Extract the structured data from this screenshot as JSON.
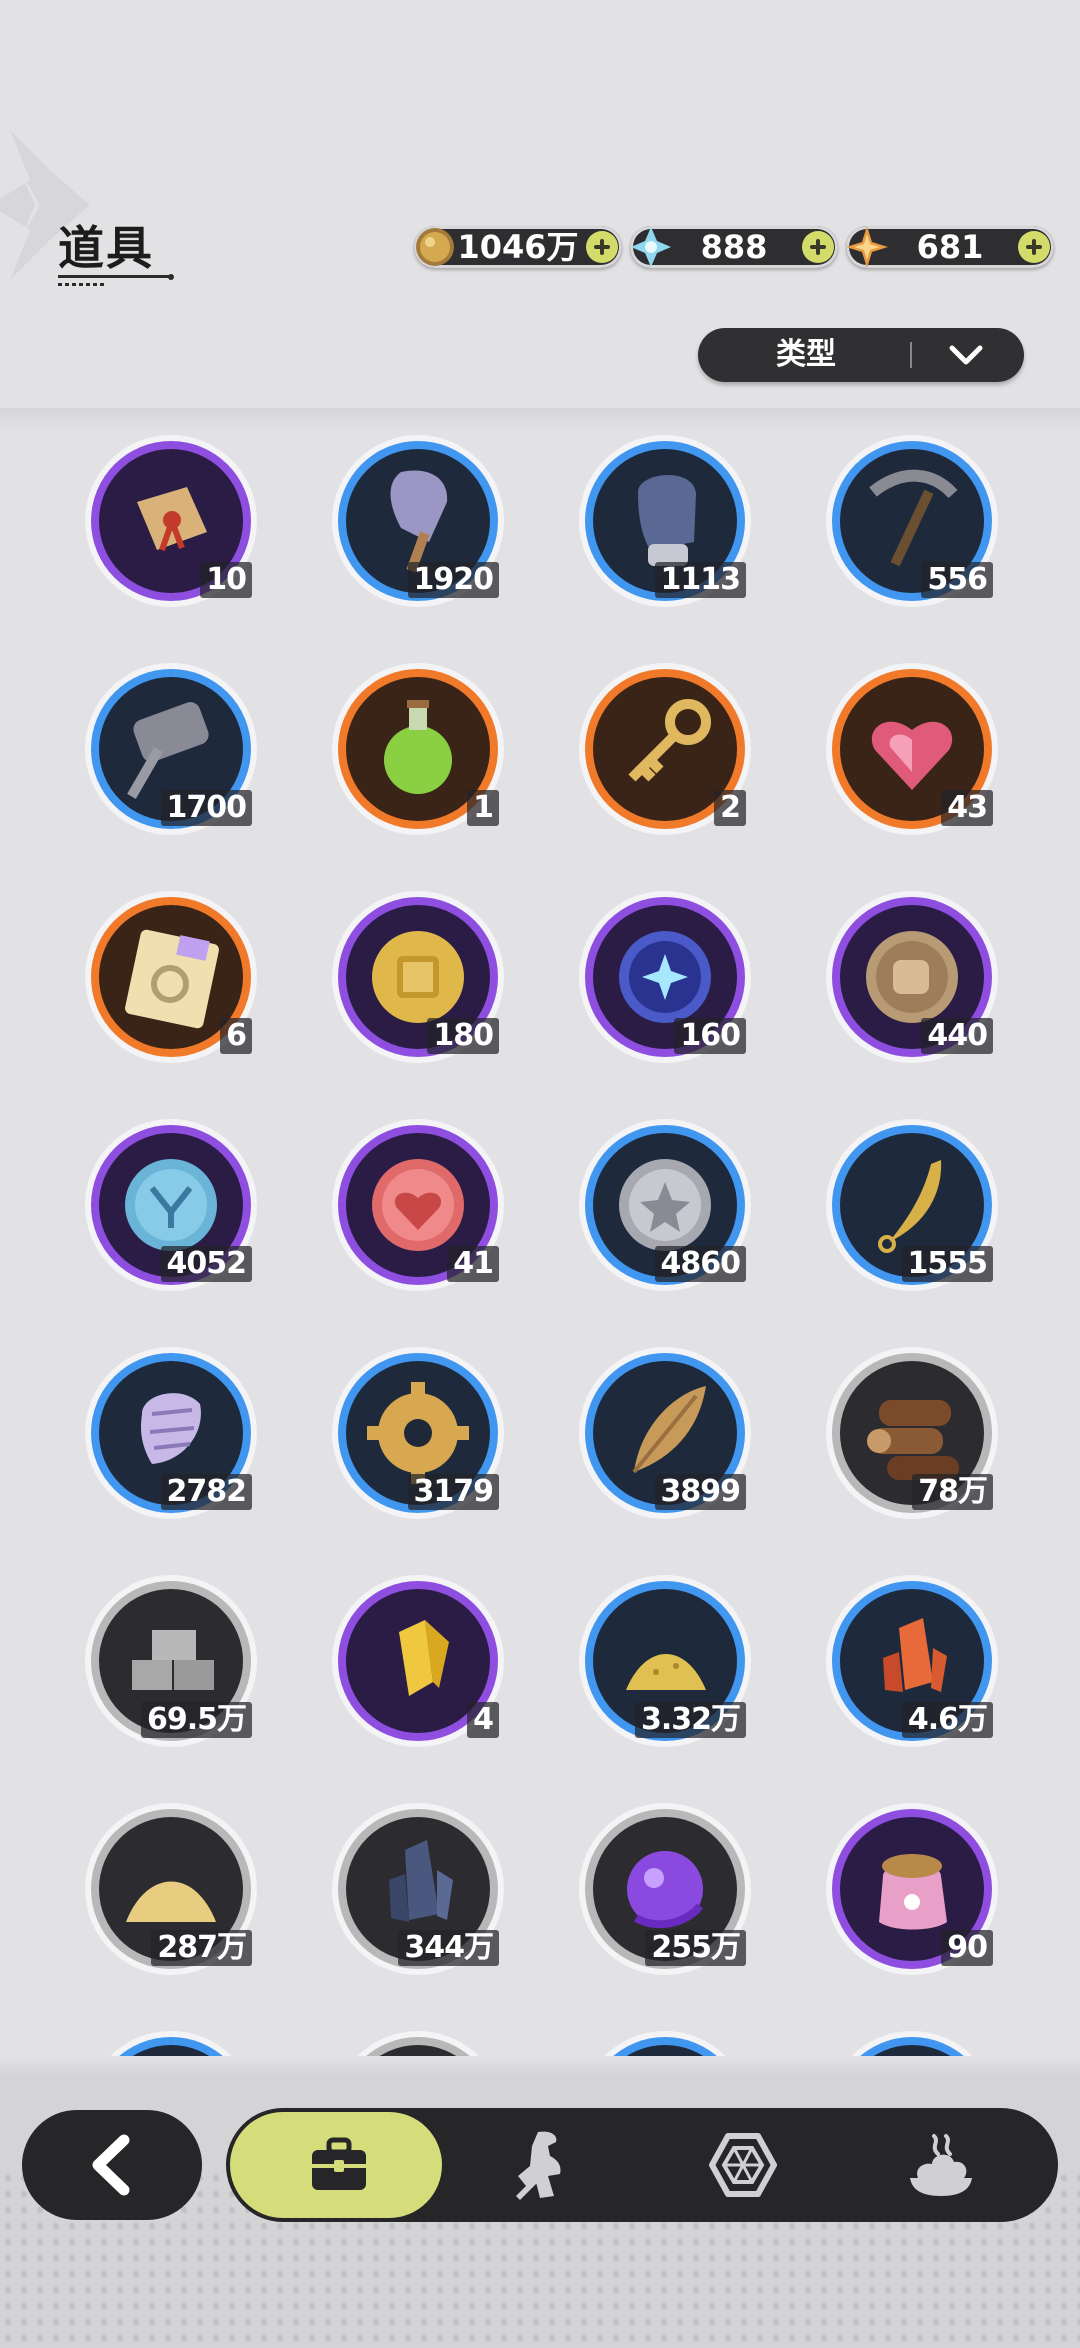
{
  "header": {
    "title": "道具"
  },
  "currencies": [
    {
      "icon": "gold-coin-icon",
      "value": "1046万"
    },
    {
      "icon": "crystal-icon",
      "value": "888"
    },
    {
      "icon": "star-gem-icon",
      "value": "681"
    }
  ],
  "filter": {
    "label": "类型"
  },
  "colors": {
    "purple": "#8e4fe0",
    "blue": "#4196f0",
    "orange": "#f07a2a",
    "gray": "#b8b8b8",
    "accent": "#d5dc7a",
    "bar": "#262628"
  },
  "items": [
    {
      "icon": "scroll-icon",
      "rarity": "purple",
      "count": "10"
    },
    {
      "icon": "shovel-icon",
      "rarity": "blue",
      "count": "1920"
    },
    {
      "icon": "glove-icon",
      "rarity": "blue",
      "count": "1113"
    },
    {
      "icon": "pickaxe-icon",
      "rarity": "blue",
      "count": "556"
    },
    {
      "icon": "hammer-icon",
      "rarity": "blue",
      "count": "1700"
    },
    {
      "icon": "potion-icon",
      "rarity": "orange",
      "count": "1"
    },
    {
      "icon": "key-icon",
      "rarity": "orange",
      "count": "2"
    },
    {
      "icon": "heart-gem-icon",
      "rarity": "orange",
      "count": "43"
    },
    {
      "icon": "ticket-icon",
      "rarity": "orange",
      "count": "6"
    },
    {
      "icon": "gold-medal-icon",
      "rarity": "purple",
      "count": "180"
    },
    {
      "icon": "star-orb-icon",
      "rarity": "purple",
      "count": "160"
    },
    {
      "icon": "fist-coin-icon",
      "rarity": "purple",
      "count": "440"
    },
    {
      "icon": "blue-coin-icon",
      "rarity": "purple",
      "count": "4052"
    },
    {
      "icon": "heart-coin-icon",
      "rarity": "purple",
      "count": "41"
    },
    {
      "icon": "silver-coin-icon",
      "rarity": "blue",
      "count": "4860"
    },
    {
      "icon": "fang-icon",
      "rarity": "blue",
      "count": "1555"
    },
    {
      "icon": "scale-icon",
      "rarity": "blue",
      "count": "2782"
    },
    {
      "icon": "gear-icon",
      "rarity": "blue",
      "count": "3179"
    },
    {
      "icon": "leaf-icon",
      "rarity": "blue",
      "count": "3899"
    },
    {
      "icon": "wood-logs-icon",
      "rarity": "gray",
      "count": "78万"
    },
    {
      "icon": "stone-bricks-icon",
      "rarity": "gray",
      "count": "69.5万"
    },
    {
      "icon": "gold-crystal-icon",
      "rarity": "purple",
      "count": "4"
    },
    {
      "icon": "gold-dust-icon",
      "rarity": "blue",
      "count": "3.32万"
    },
    {
      "icon": "red-crystal-icon",
      "rarity": "blue",
      "count": "4.6万"
    },
    {
      "icon": "sand-pile-icon",
      "rarity": "gray",
      "count": "287万"
    },
    {
      "icon": "dark-crystal-icon",
      "rarity": "gray",
      "count": "344万"
    },
    {
      "icon": "purple-orb-icon",
      "rarity": "gray",
      "count": "255万"
    },
    {
      "icon": "food-bag-icon",
      "rarity": "purple",
      "count": "90"
    },
    {
      "icon": "partial-item-icon",
      "rarity": "blue",
      "count": ""
    },
    {
      "icon": "partial-item-icon",
      "rarity": "gray",
      "count": ""
    },
    {
      "icon": "partial-item-icon",
      "rarity": "blue",
      "count": ""
    },
    {
      "icon": "partial-item-icon",
      "rarity": "blue",
      "count": ""
    }
  ],
  "nav": {
    "back_icon": "back-arrow-icon",
    "tabs": [
      {
        "icon": "bag-icon",
        "active": true
      },
      {
        "icon": "character-icon",
        "active": false
      },
      {
        "icon": "hexagon-icon",
        "active": false
      },
      {
        "icon": "food-icon",
        "active": false
      }
    ]
  }
}
